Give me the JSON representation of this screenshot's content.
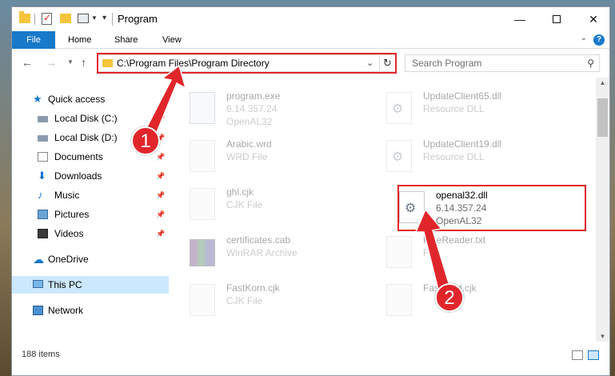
{
  "window": {
    "title": "Program",
    "controls": {
      "minimize": "—",
      "maximize": "",
      "close": "✕"
    }
  },
  "ribbon": {
    "tabs": [
      "File",
      "Home",
      "Share",
      "View"
    ],
    "help": "?"
  },
  "address": {
    "path": "C:\\Program Files\\Program Directory",
    "refresh": "↻"
  },
  "search": {
    "placeholder": "Search Program",
    "icon": "search-icon"
  },
  "nav": {
    "items": [
      {
        "label": "Quick access",
        "icon": "star-icon"
      },
      {
        "label": "Local Disk (C:)",
        "icon": "disk-icon"
      },
      {
        "label": "Local Disk (D:)",
        "icon": "disk-icon"
      },
      {
        "label": "Documents",
        "icon": "document-icon"
      },
      {
        "label": "Downloads",
        "icon": "download-icon"
      },
      {
        "label": "Music",
        "icon": "music-icon"
      },
      {
        "label": "Pictures",
        "icon": "pictures-icon"
      },
      {
        "label": "Videos",
        "icon": "videos-icon"
      },
      {
        "label": "OneDrive",
        "icon": "cloud-icon"
      },
      {
        "label": "This PC",
        "icon": "computer-icon"
      },
      {
        "label": "Network",
        "icon": "network-icon"
      }
    ]
  },
  "files": [
    {
      "name": "program.exe",
      "line2": "6.14.357.24",
      "line3": "OpenAL32"
    },
    {
      "name": "UpdateClient65.dll",
      "line2": "Resource DLL",
      "line3": ""
    },
    {
      "name": "Arabic.wrd",
      "line2": "WRD File",
      "line3": ""
    },
    {
      "name": "UpdateClient19.dll",
      "line2": "Resource DLL",
      "line3": ""
    },
    {
      "name": "ghl.cjk",
      "line2": "CJK File",
      "line3": ""
    },
    {
      "name": "openal32.dll",
      "line2": "6.14.357.24",
      "line3": "OpenAL32"
    },
    {
      "name": "certificates.cab",
      "line2": "WinRAR Archive",
      "line3": ""
    },
    {
      "name": "FineReader.txt",
      "line2": "File",
      "line3": ""
    },
    {
      "name": "FastKorn.cjk",
      "line2": "CJK File",
      "line3": ""
    },
    {
      "name": "FastKord.cjk",
      "line2": "",
      "line3": ""
    }
  ],
  "status": {
    "count": "188 items"
  },
  "callouts": {
    "one": "1",
    "two": "2"
  },
  "colors": {
    "accent": "#1979ca",
    "highlight": "#e0262b",
    "selection": "#cce8ff"
  }
}
